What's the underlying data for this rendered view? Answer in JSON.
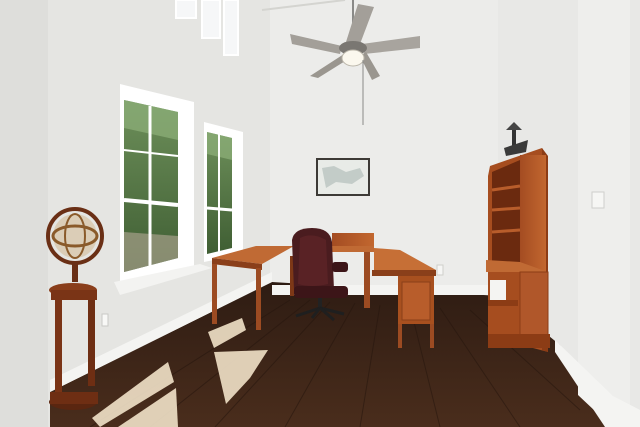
{
  "image": {
    "subject": "home-office-room",
    "colors": {
      "left_wall": "#e6e6e3",
      "back_wall": "#ececea",
      "right_wall": "#e9e9e7",
      "floor": "#3a2418",
      "wood_furniture": "#b55a2a",
      "chair": "#4a1c1f",
      "sunlight": "#f3e6cf"
    }
  }
}
